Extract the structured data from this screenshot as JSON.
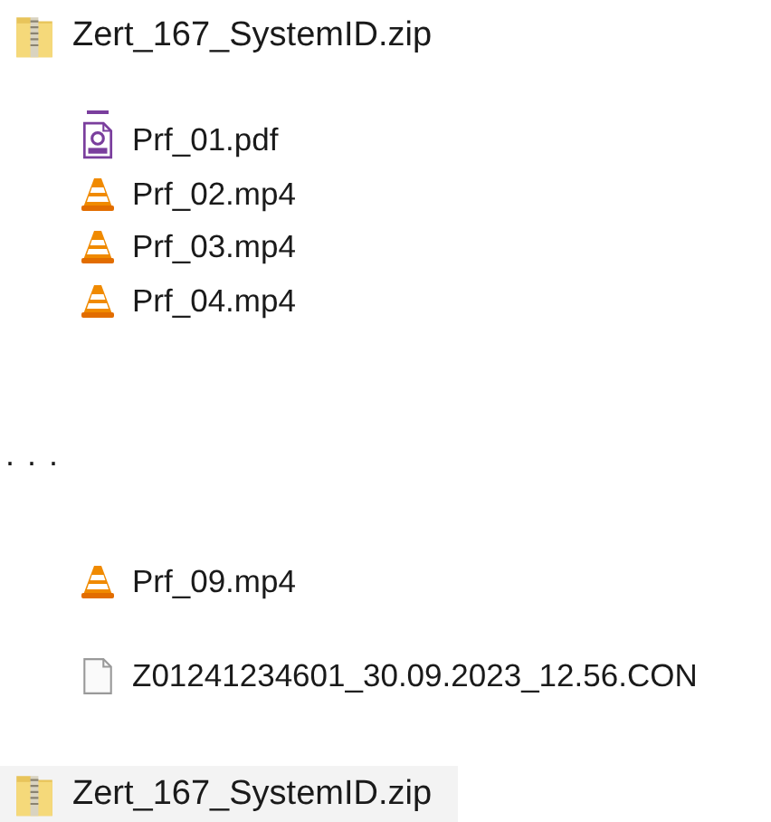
{
  "archive_top": {
    "name": "Zert_167_SystemID.zip",
    "selected": false
  },
  "files_top": [
    {
      "kind": "pdf",
      "name": "Prf_01.pdf"
    },
    {
      "kind": "video",
      "name": "Prf_02.mp4"
    },
    {
      "kind": "video",
      "name": "Prf_03.mp4"
    },
    {
      "kind": "video",
      "name": "Prf_04.mp4"
    }
  ],
  "ellipsis": ". . .",
  "files_bottom": [
    {
      "kind": "video",
      "name": "Prf_09.mp4"
    },
    {
      "kind": "file",
      "name": "Z01241234601_30.09.2023_12.56.CON"
    }
  ],
  "archive_bottom": {
    "name": "Zert_167_SystemID.zip",
    "selected": true
  }
}
